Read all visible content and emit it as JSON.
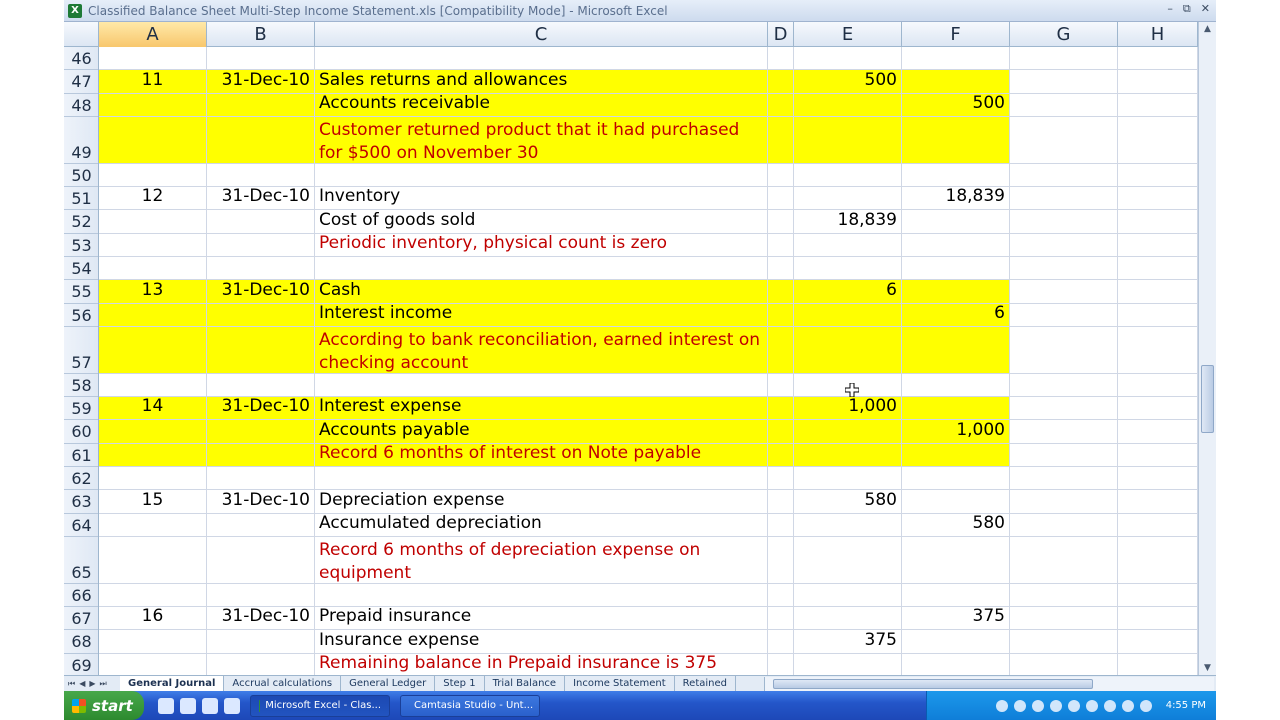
{
  "window": {
    "title": "Classified Balance Sheet Multi-Step Income Statement.xls  [Compatibility Mode] - Microsoft Excel",
    "icon": "excel-icon"
  },
  "columns": [
    {
      "id": "A",
      "label": "A",
      "selected": true
    },
    {
      "id": "B",
      "label": "B",
      "selected": false
    },
    {
      "id": "C",
      "label": "C",
      "selected": false
    },
    {
      "id": "D",
      "label": "D",
      "selected": false
    },
    {
      "id": "E",
      "label": "E",
      "selected": false
    },
    {
      "id": "F",
      "label": "F",
      "selected": false
    },
    {
      "id": "G",
      "label": "G",
      "selected": false
    },
    {
      "id": "H",
      "label": "H",
      "selected": false
    }
  ],
  "rows": [
    {
      "num": "46",
      "tall": false,
      "yellow": false,
      "A": "",
      "B": "",
      "C": "",
      "C_red": false,
      "E": "",
      "F": ""
    },
    {
      "num": "47",
      "tall": false,
      "yellow": true,
      "A": "11",
      "B": "31-Dec-10",
      "C": "Sales returns and allowances",
      "C_red": false,
      "E": "500",
      "F": ""
    },
    {
      "num": "48",
      "tall": false,
      "yellow": true,
      "A": "",
      "B": "",
      "C": "Accounts receivable",
      "C_red": false,
      "E": "",
      "F": "500"
    },
    {
      "num": "49",
      "tall": true,
      "yellow": true,
      "A": "",
      "B": "",
      "C": "Customer returned product that it had purchased for $500 on November 30",
      "C_red": true,
      "E": "",
      "F": ""
    },
    {
      "num": "50",
      "tall": false,
      "yellow": false,
      "A": "",
      "B": "",
      "C": "",
      "C_red": false,
      "E": "",
      "F": ""
    },
    {
      "num": "51",
      "tall": false,
      "yellow": false,
      "A": "12",
      "B": "31-Dec-10",
      "C": "Inventory",
      "C_red": false,
      "E": "",
      "F": "18,839"
    },
    {
      "num": "52",
      "tall": false,
      "yellow": false,
      "A": "",
      "B": "",
      "C": "Cost of goods sold",
      "C_red": false,
      "E": "18,839",
      "F": ""
    },
    {
      "num": "53",
      "tall": false,
      "yellow": false,
      "A": "",
      "B": "",
      "C": "Periodic inventory, physical count is zero",
      "C_red": true,
      "E": "",
      "F": ""
    },
    {
      "num": "54",
      "tall": false,
      "yellow": false,
      "A": "",
      "B": "",
      "C": "",
      "C_red": false,
      "E": "",
      "F": ""
    },
    {
      "num": "55",
      "tall": false,
      "yellow": true,
      "A": "13",
      "B": "31-Dec-10",
      "C": "Cash",
      "C_red": false,
      "E": "6",
      "F": ""
    },
    {
      "num": "56",
      "tall": false,
      "yellow": true,
      "A": "",
      "B": "",
      "C": "Interest income",
      "C_red": false,
      "E": "",
      "F": "6"
    },
    {
      "num": "57",
      "tall": true,
      "yellow": true,
      "A": "",
      "B": "",
      "C": "According to bank reconciliation, earned interest on checking account",
      "C_red": true,
      "E": "",
      "F": ""
    },
    {
      "num": "58",
      "tall": false,
      "yellow": false,
      "A": "",
      "B": "",
      "C": "",
      "C_red": false,
      "E": "",
      "F": ""
    },
    {
      "num": "59",
      "tall": false,
      "yellow": true,
      "A": "14",
      "B": "31-Dec-10",
      "C": "Interest expense",
      "C_red": false,
      "E": "1,000",
      "F": ""
    },
    {
      "num": "60",
      "tall": false,
      "yellow": true,
      "A": "",
      "B": "",
      "C": "Accounts payable",
      "C_red": false,
      "E": "",
      "F": "1,000"
    },
    {
      "num": "61",
      "tall": false,
      "yellow": true,
      "A": "",
      "B": "",
      "C": "Record 6 months of interest on Note payable",
      "C_red": true,
      "E": "",
      "F": ""
    },
    {
      "num": "62",
      "tall": false,
      "yellow": false,
      "A": "",
      "B": "",
      "C": "",
      "C_red": false,
      "E": "",
      "F": ""
    },
    {
      "num": "63",
      "tall": false,
      "yellow": false,
      "A": "15",
      "B": "31-Dec-10",
      "C": "Depreciation expense",
      "C_red": false,
      "E": "580",
      "F": ""
    },
    {
      "num": "64",
      "tall": false,
      "yellow": false,
      "A": "",
      "B": "",
      "C": "Accumulated depreciation",
      "C_red": false,
      "E": "",
      "F": "580"
    },
    {
      "num": "65",
      "tall": true,
      "yellow": false,
      "A": "",
      "B": "",
      "C": "Record 6 months of depreciation expense on equipment",
      "C_red": true,
      "E": "",
      "F": ""
    },
    {
      "num": "66",
      "tall": false,
      "yellow": false,
      "A": "",
      "B": "",
      "C": "",
      "C_red": false,
      "E": "",
      "F": ""
    },
    {
      "num": "67",
      "tall": false,
      "yellow": false,
      "A": "16",
      "B": "31-Dec-10",
      "C": "Prepaid insurance",
      "C_red": false,
      "E": "",
      "F": "375"
    },
    {
      "num": "68",
      "tall": false,
      "yellow": false,
      "A": "",
      "B": "",
      "C": "Insurance expense",
      "C_red": false,
      "E": "375",
      "F": ""
    },
    {
      "num": "69",
      "tall": false,
      "yellow": false,
      "A": "",
      "B": "",
      "C": "Remaining balance in Prepaid insurance is 375",
      "C_red": true,
      "E": "",
      "F": ""
    }
  ],
  "sheet_tabs": [
    {
      "label": "General Journal",
      "active": true
    },
    {
      "label": "Accrual calculations",
      "active": false
    },
    {
      "label": "General Ledger",
      "active": false
    },
    {
      "label": "Step 1",
      "active": false
    },
    {
      "label": "Trial Balance",
      "active": false
    },
    {
      "label": "Income Statement",
      "active": false
    },
    {
      "label": "Retained",
      "active": false
    }
  ],
  "taskbar": {
    "start_label": "start",
    "buttons": [
      {
        "label": "Microsoft Excel - Clas...",
        "active": true,
        "icon": "excel-icon"
      },
      {
        "label": "Camtasia Studio - Unt...",
        "active": false,
        "icon": "camtasia-icon"
      }
    ],
    "clock": "4:55 PM"
  },
  "colors": {
    "highlight": "#ffff00",
    "note_text": "#c00000"
  }
}
